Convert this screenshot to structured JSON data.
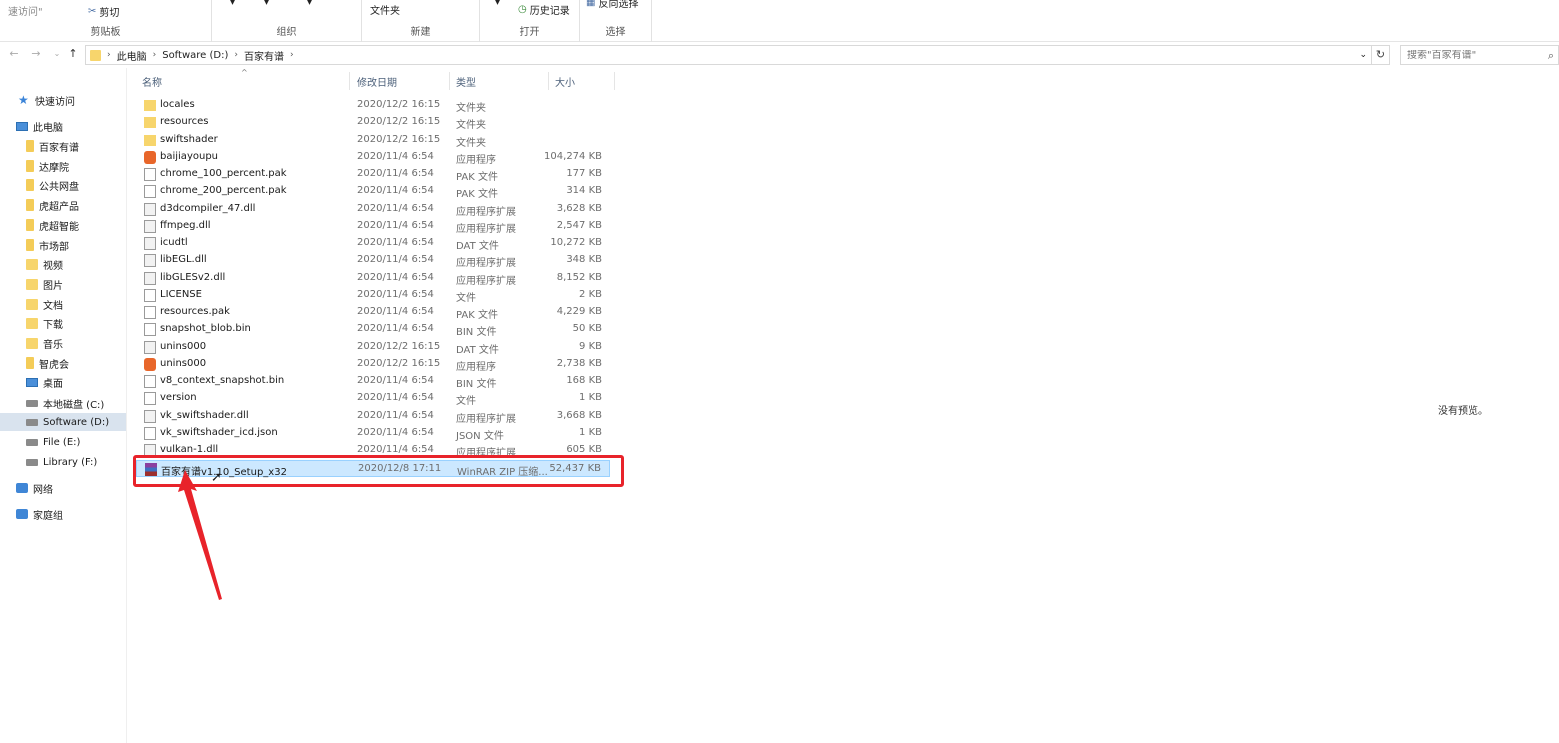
{
  "ribbon": {
    "quick_access_text": "速访问\"",
    "cut_label": "剪切",
    "clipboard_group": "剪贴板",
    "organize_group": "组织",
    "new_folder_label": "文件夹",
    "new_group": "新建",
    "history_label": "历史记录",
    "open_group": "打开",
    "select_inverse_label": "反向选择",
    "select_group": "选择"
  },
  "address": {
    "crumbs": [
      "此电脑",
      "Software (D:)",
      "百家有谱"
    ]
  },
  "search": {
    "placeholder": "搜索\"百家有谱\""
  },
  "nav": {
    "items": [
      {
        "label": "快速访问",
        "icon": "star-icon"
      },
      {
        "label": "此电脑",
        "icon": "pc-icon"
      },
      {
        "label": "百家有谱",
        "icon": "folder-icon"
      },
      {
        "label": "达摩院",
        "icon": "folder-icon"
      },
      {
        "label": "公共网盘",
        "icon": "folder-icon"
      },
      {
        "label": "虎超产品",
        "icon": "folder-icon"
      },
      {
        "label": "虎超智能",
        "icon": "folder-icon"
      },
      {
        "label": "市场部",
        "icon": "folder-icon"
      },
      {
        "label": "视频",
        "icon": "video-icon"
      },
      {
        "label": "图片",
        "icon": "pictures-icon"
      },
      {
        "label": "文档",
        "icon": "documents-icon"
      },
      {
        "label": "下载",
        "icon": "download-icon"
      },
      {
        "label": "音乐",
        "icon": "music-icon"
      },
      {
        "label": "智虎会",
        "icon": "folder-icon"
      },
      {
        "label": "桌面",
        "icon": "desktop-icon"
      },
      {
        "label": "本地磁盘 (C:)",
        "icon": "drive-icon"
      },
      {
        "label": "Software (D:)",
        "icon": "drive-icon"
      },
      {
        "label": "File (E:)",
        "icon": "drive-icon"
      },
      {
        "label": "Library (F:)",
        "icon": "drive-icon"
      },
      {
        "label": "网络",
        "icon": "network-icon"
      },
      {
        "label": "家庭组",
        "icon": "homegroup-icon"
      }
    ]
  },
  "columns": {
    "name": "名称",
    "date": "修改日期",
    "type": "类型",
    "size": "大小"
  },
  "files": [
    {
      "name": "locales",
      "date": "2020/12/2 16:15",
      "type": "文件夹",
      "size": "",
      "icon": "folder"
    },
    {
      "name": "resources",
      "date": "2020/12/2 16:15",
      "type": "文件夹",
      "size": "",
      "icon": "folder"
    },
    {
      "name": "swiftshader",
      "date": "2020/12/2 16:15",
      "type": "文件夹",
      "size": "",
      "icon": "folder"
    },
    {
      "name": "baijiayoupu",
      "date": "2020/11/4 6:54",
      "type": "应用程序",
      "size": "104,274 KB",
      "icon": "app"
    },
    {
      "name": "chrome_100_percent.pak",
      "date": "2020/11/4 6:54",
      "type": "PAK 文件",
      "size": "177 KB",
      "icon": "file"
    },
    {
      "name": "chrome_200_percent.pak",
      "date": "2020/11/4 6:54",
      "type": "PAK 文件",
      "size": "314 KB",
      "icon": "file"
    },
    {
      "name": "d3dcompiler_47.dll",
      "date": "2020/11/4 6:54",
      "type": "应用程序扩展",
      "size": "3,628 KB",
      "icon": "dll"
    },
    {
      "name": "ffmpeg.dll",
      "date": "2020/11/4 6:54",
      "type": "应用程序扩展",
      "size": "2,547 KB",
      "icon": "dll"
    },
    {
      "name": "icudtl",
      "date": "2020/11/4 6:54",
      "type": "DAT 文件",
      "size": "10,272 KB",
      "icon": "dll"
    },
    {
      "name": "libEGL.dll",
      "date": "2020/11/4 6:54",
      "type": "应用程序扩展",
      "size": "348 KB",
      "icon": "dll"
    },
    {
      "name": "libGLESv2.dll",
      "date": "2020/11/4 6:54",
      "type": "应用程序扩展",
      "size": "8,152 KB",
      "icon": "dll"
    },
    {
      "name": "LICENSE",
      "date": "2020/11/4 6:54",
      "type": "文件",
      "size": "2 KB",
      "icon": "file"
    },
    {
      "name": "resources.pak",
      "date": "2020/11/4 6:54",
      "type": "PAK 文件",
      "size": "4,229 KB",
      "icon": "file"
    },
    {
      "name": "snapshot_blob.bin",
      "date": "2020/11/4 6:54",
      "type": "BIN 文件",
      "size": "50 KB",
      "icon": "file"
    },
    {
      "name": "unins000",
      "date": "2020/12/2 16:15",
      "type": "DAT 文件",
      "size": "9 KB",
      "icon": "dll"
    },
    {
      "name": "unins000",
      "date": "2020/12/2 16:15",
      "type": "应用程序",
      "size": "2,738 KB",
      "icon": "app"
    },
    {
      "name": "v8_context_snapshot.bin",
      "date": "2020/11/4 6:54",
      "type": "BIN 文件",
      "size": "168 KB",
      "icon": "file"
    },
    {
      "name": "version",
      "date": "2020/11/4 6:54",
      "type": "文件",
      "size": "1 KB",
      "icon": "file"
    },
    {
      "name": "vk_swiftshader.dll",
      "date": "2020/11/4 6:54",
      "type": "应用程序扩展",
      "size": "3,668 KB",
      "icon": "dll"
    },
    {
      "name": "vk_swiftshader_icd.json",
      "date": "2020/11/4 6:54",
      "type": "JSON 文件",
      "size": "1 KB",
      "icon": "file"
    },
    {
      "name": "vulkan-1.dll",
      "date": "2020/11/4 6:54",
      "type": "应用程序扩展",
      "size": "605 KB",
      "icon": "dll"
    },
    {
      "name": "百家有谱v1.10_Setup_x32",
      "date": "2020/12/8 17:11",
      "type": "WinRAR ZIP 压缩...",
      "size": "52,437 KB",
      "icon": "rar",
      "selected": true
    }
  ],
  "preview": {
    "text": "没有预览。"
  },
  "colors": {
    "annotation": "#e8232a",
    "selection": "#cce8ff"
  }
}
